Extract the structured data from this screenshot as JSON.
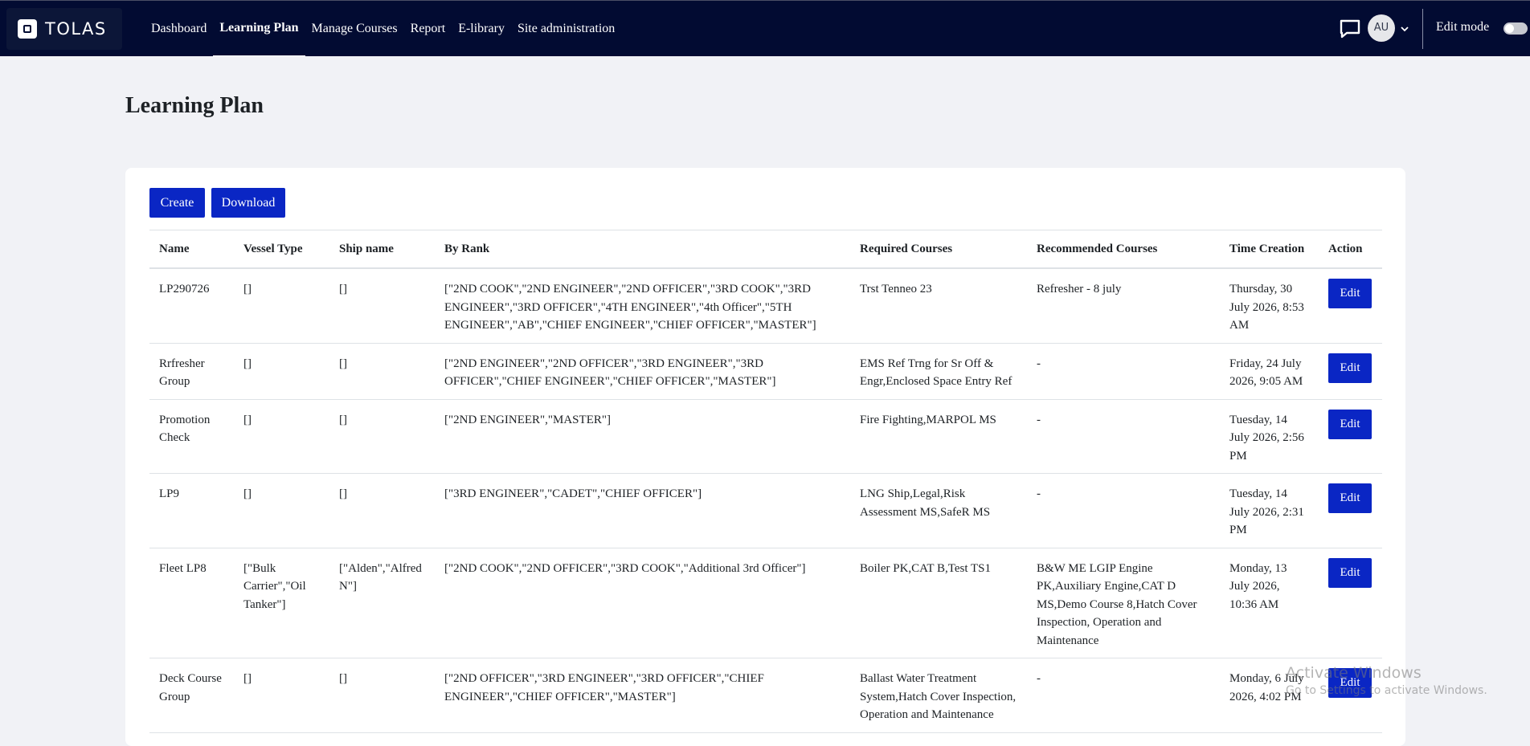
{
  "navbar": {
    "brand": "TOLAS",
    "links": [
      "Dashboard",
      "Learning Plan",
      "Manage Courses",
      "Report",
      "E-library",
      "Site administration"
    ],
    "active_index": 1,
    "avatar_initials": "AU",
    "edit_mode_label": "Edit mode",
    "bg_color": "#020b32"
  },
  "page": {
    "title": "Learning Plan",
    "create_label": "Create",
    "download_label": "Download",
    "accent_color": "#0a26c4"
  },
  "table": {
    "headers": [
      "Name",
      "Vessel Type",
      "Ship name",
      "By Rank",
      "Required Courses",
      "Recommended Courses",
      "Time Creation",
      "Action"
    ],
    "rows": [
      {
        "name": "LP290726",
        "vessel_type": "[]",
        "ship_name": "[]",
        "by_rank": "[\"2ND COOK\",\"2ND ENGINEER\",\"2ND OFFICER\",\"3RD COOK\",\"3RD ENGINEER\",\"3RD OFFICER\",\"4TH ENGINEER\",\"4th Officer\",\"5TH ENGINEER\",\"AB\",\"CHIEF ENGINEER\",\"CHIEF OFFICER\",\"MASTER\"]",
        "required": "Trst Tenneo 23",
        "recommended": "Refresher - 8 july",
        "time": "Thursday, 30 July 2026, 8:53 AM",
        "action": "Edit"
      },
      {
        "name": "Rrfresher Group",
        "vessel_type": "[]",
        "ship_name": "[]",
        "by_rank": "[\"2ND ENGINEER\",\"2ND OFFICER\",\"3RD ENGINEER\",\"3RD OFFICER\",\"CHIEF ENGINEER\",\"CHIEF OFFICER\",\"MASTER\"]",
        "required": "EMS Ref Trng for Sr Off & Engr,Enclosed Space Entry Ref",
        "recommended": "-",
        "time": "Friday, 24 July 2026, 9:05 AM",
        "action": "Edit"
      },
      {
        "name": "Promotion Check",
        "vessel_type": "[]",
        "ship_name": "[]",
        "by_rank": "[\"2ND ENGINEER\",\"MASTER\"]",
        "required": "Fire Fighting,MARPOL MS",
        "recommended": "-",
        "time": "Tuesday, 14 July 2026, 2:56 PM",
        "action": "Edit"
      },
      {
        "name": "LP9",
        "vessel_type": "[]",
        "ship_name": "[]",
        "by_rank": "[\"3RD ENGINEER\",\"CADET\",\"CHIEF OFFICER\"]",
        "required": "LNG Ship,Legal,Risk Assessment MS,SafeR MS",
        "recommended": "-",
        "time": "Tuesday, 14 July 2026, 2:31 PM",
        "action": "Edit"
      },
      {
        "name": "Fleet LP8",
        "vessel_type": "[\"Bulk Carrier\",\"Oil Tanker\"]",
        "ship_name": "[\"Alden\",\"Alfred N\"]",
        "by_rank": "[\"2ND COOK\",\"2ND OFFICER\",\"3RD COOK\",\"Additional 3rd Officer\"]",
        "required": "Boiler PK,CAT B,Test TS1",
        "recommended": "B&W ME LGIP Engine PK,Auxiliary Engine,CAT D MS,Demo Course 8,Hatch Cover Inspection, Operation and Maintenance",
        "time": "Monday, 13 July 2026, 10:36 AM",
        "action": "Edit"
      },
      {
        "name": "Deck Course Group",
        "vessel_type": "[]",
        "ship_name": "[]",
        "by_rank": "[\"2ND OFFICER\",\"3RD ENGINEER\",\"3RD OFFICER\",\"CHIEF ENGINEER\",\"CHIEF OFFICER\",\"MASTER\"]",
        "required": "Ballast Water Treatment System,Hatch Cover Inspection, Operation and Maintenance",
        "recommended": "-",
        "time": "Monday, 6 July 2026, 4:02 PM",
        "action": "Edit"
      }
    ]
  },
  "watermark": {
    "line1": "Activate Windows",
    "line2": "Go to Settings to activate Windows."
  }
}
